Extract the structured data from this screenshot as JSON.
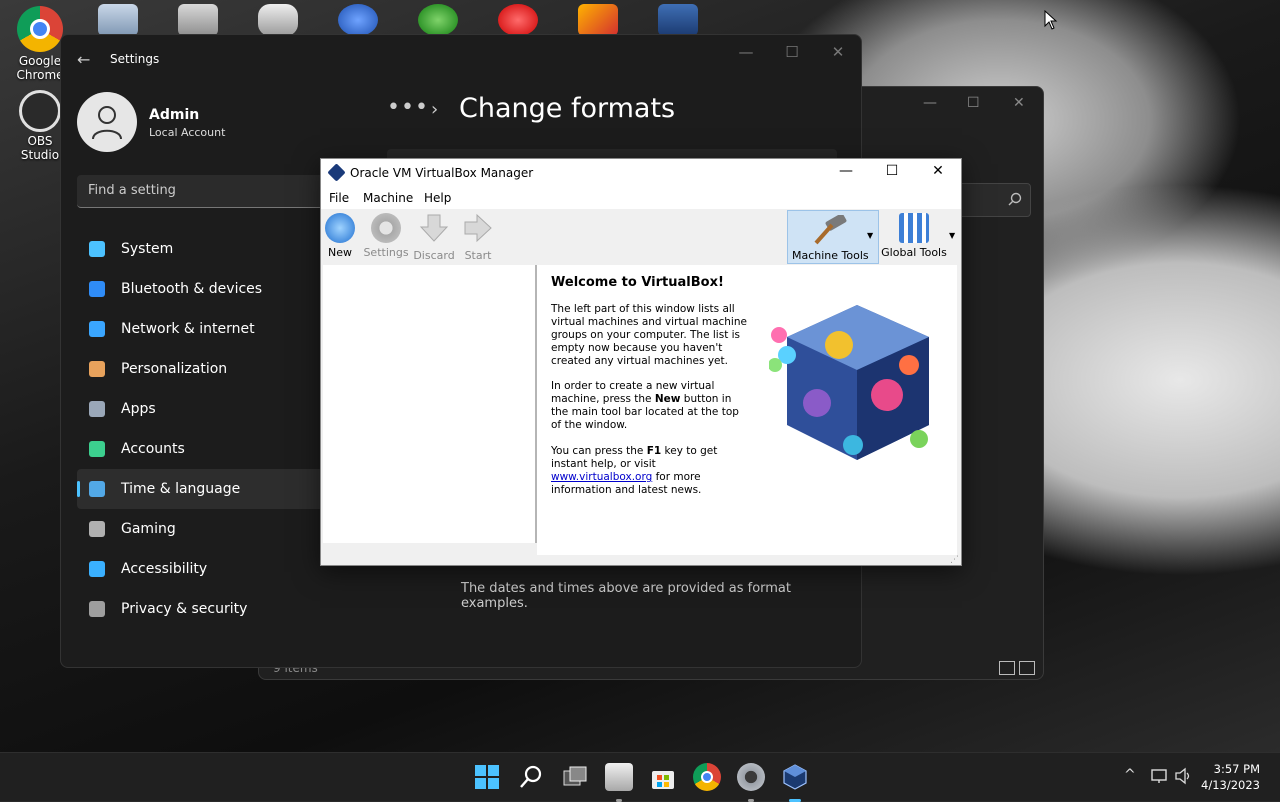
{
  "desktop": {
    "icons": [
      {
        "name": "desktop-icon-google-chrome",
        "label": "Google Chrome"
      },
      {
        "name": "desktop-icon-obs-studio",
        "label": "OBS Studio"
      }
    ]
  },
  "explorer": {
    "footer_count": "9 items",
    "minimize": "—",
    "maximize": "☐",
    "close": "✕"
  },
  "settings": {
    "app_title": "Settings",
    "back_icon": "←",
    "user": {
      "name": "Admin",
      "subtitle": "Local Account"
    },
    "search_placeholder": "Find a setting",
    "nav": [
      {
        "label": "System",
        "color": "#4cc2ff"
      },
      {
        "label": "Bluetooth & devices",
        "color": "#2f8cf7"
      },
      {
        "label": "Network & internet",
        "color": "#3aa6ff"
      },
      {
        "label": "Personalization",
        "color": "#e8a25c"
      },
      {
        "label": "Apps",
        "color": "#9aa7b8"
      },
      {
        "label": "Accounts",
        "color": "#3ccf8e"
      },
      {
        "label": "Time & language",
        "color": "#52a8e6"
      },
      {
        "label": "Gaming",
        "color": "#b0b0b0"
      },
      {
        "label": "Accessibility",
        "color": "#3ab0ff"
      },
      {
        "label": "Privacy & security",
        "color": "#9e9e9e"
      }
    ],
    "active_nav": "Time & language",
    "breadcrumb_dots": "•••",
    "breadcrumb_chevron": "›",
    "page_title": "Change formats",
    "format_note": "The dates and times above are provided as format examples.",
    "minimize": "—",
    "maximize": "☐",
    "close": "✕"
  },
  "vbox": {
    "title": "Oracle VM VirtualBox Manager",
    "minimize": "—",
    "maximize": "☐",
    "close": "✕",
    "menu": [
      "File",
      "Machine",
      "Help"
    ],
    "toolbar": {
      "new": "New",
      "settings": "Settings",
      "discard": "Discard",
      "start": "Start",
      "machine_tools": "Machine Tools",
      "global_tools": "Global Tools"
    },
    "welcome": {
      "title": "Welcome to VirtualBox!",
      "p1": "The left part of this window lists all virtual machines and virtual machine groups on your computer. The list is empty now because you haven't created any virtual machines yet.",
      "p2_before": "In order to create a new virtual machine, press the ",
      "p2_bold": "New",
      "p2_after": " button in the main tool bar located at the top of the window.",
      "p3_before": "You can press the ",
      "p3_bold": "F1",
      "p3_mid": " key to get instant help, or visit ",
      "p3_link": "www.virtualbox.org",
      "p3_after": " for more information and latest news."
    }
  },
  "taskbar": {
    "tray_chevron": "^",
    "time": "3:57 PM",
    "date": "4/13/2023"
  }
}
